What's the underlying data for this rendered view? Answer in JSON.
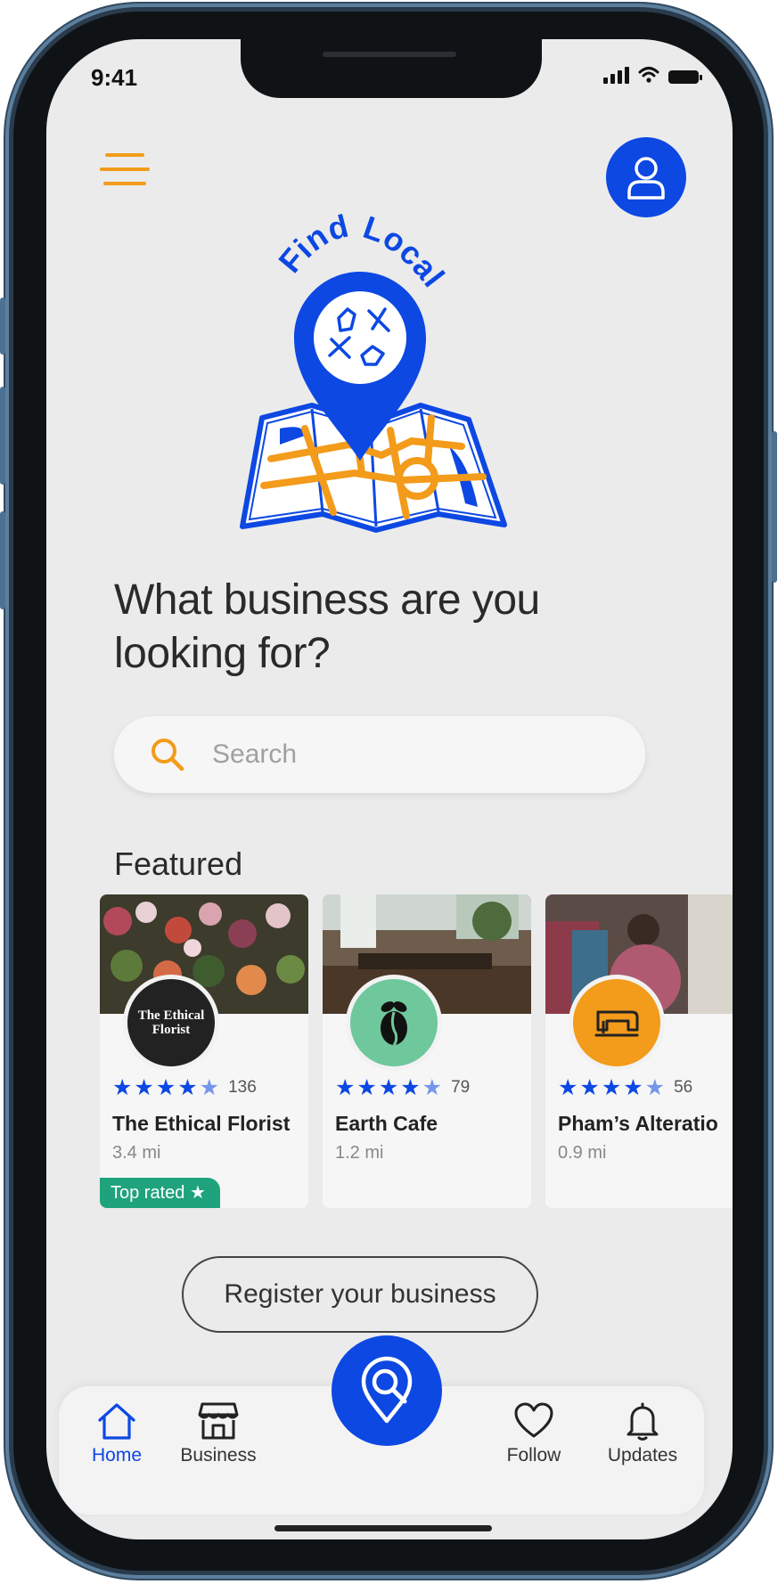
{
  "status_bar": {
    "time": "9:41"
  },
  "header": {
    "menu_icon": "hamburger-menu-icon",
    "profile_icon": "user-profile-icon"
  },
  "logo": {
    "text": "Find Local",
    "icon": "map-pin-logo",
    "colors": {
      "brand_blue": "#0d48e3",
      "accent_orange": "#f39b1a"
    }
  },
  "main": {
    "headline": "What business are you looking for?",
    "search": {
      "placeholder": "Search",
      "icon": "search-icon"
    },
    "featured_title": "Featured",
    "featured": [
      {
        "name": "The Ethical Florist",
        "distance": "3.4 mi",
        "rating_count": "136",
        "rating": 4.5,
        "logo_text": "The Ethical Florist",
        "badge": "Top rated ★"
      },
      {
        "name": "Earth Cafe",
        "distance": "1.2 mi",
        "rating_count": "79",
        "rating": 4.5,
        "logo_icon": "coffee-bean-icon"
      },
      {
        "name": "Pham’s Alteratio",
        "distance": "0.9 mi",
        "rating_count": "56",
        "rating": 4.5,
        "logo_icon": "sewing-machine-icon"
      }
    ],
    "register_label": "Register your business"
  },
  "tabbar": {
    "items": [
      {
        "label": "Home",
        "icon": "home-icon",
        "active": true
      },
      {
        "label": "Business",
        "icon": "storefront-icon"
      },
      {
        "label": "Follow",
        "icon": "heart-icon"
      },
      {
        "label": "Updates",
        "icon": "bell-icon"
      }
    ],
    "center_icon": "location-search-icon"
  }
}
